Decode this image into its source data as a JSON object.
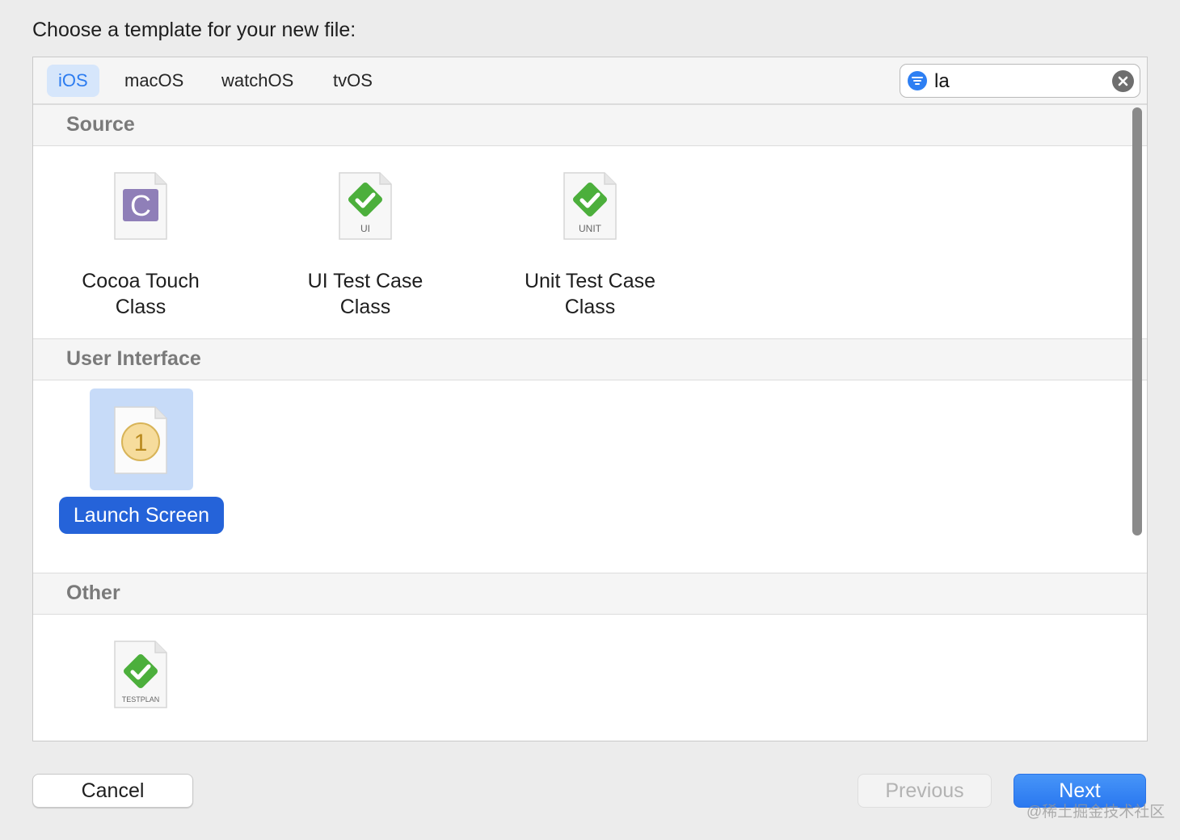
{
  "dialog": {
    "prompt": "Choose a template for your new file:"
  },
  "platform_tabs": [
    {
      "label": "iOS",
      "selected": true
    },
    {
      "label": "macOS",
      "selected": false
    },
    {
      "label": "watchOS",
      "selected": false
    },
    {
      "label": "tvOS",
      "selected": false
    }
  ],
  "search": {
    "value": "la"
  },
  "sections": [
    {
      "title": "Source",
      "templates": [
        {
          "label_line1": "Cocoa Touch",
          "label_line2": "Class",
          "icon": "cocoa-touch-class-icon",
          "badge": "C"
        },
        {
          "label_line1": "UI Test Case",
          "label_line2": "Class",
          "icon": "ui-test-case-class-icon",
          "badge": "UI"
        },
        {
          "label_line1": "Unit Test Case",
          "label_line2": "Class",
          "icon": "unit-test-case-class-icon",
          "badge": "UNIT"
        }
      ]
    },
    {
      "title": "User Interface",
      "templates": [
        {
          "label": "Launch Screen",
          "icon": "launch-screen-icon",
          "badge": "1",
          "selected": true
        }
      ]
    },
    {
      "title": "Other",
      "templates": [
        {
          "label": "",
          "icon": "test-plan-icon",
          "badge": "TESTPLAN"
        }
      ]
    }
  ],
  "buttons": {
    "cancel": "Cancel",
    "previous": "Previous",
    "next": "Next"
  },
  "watermark": "@稀土掘金技术社区",
  "colors": {
    "accent": "#2c7cf0",
    "selection": "#2563d9",
    "check_green": "#4caf3c",
    "class_purple": "#8f7fb8"
  }
}
